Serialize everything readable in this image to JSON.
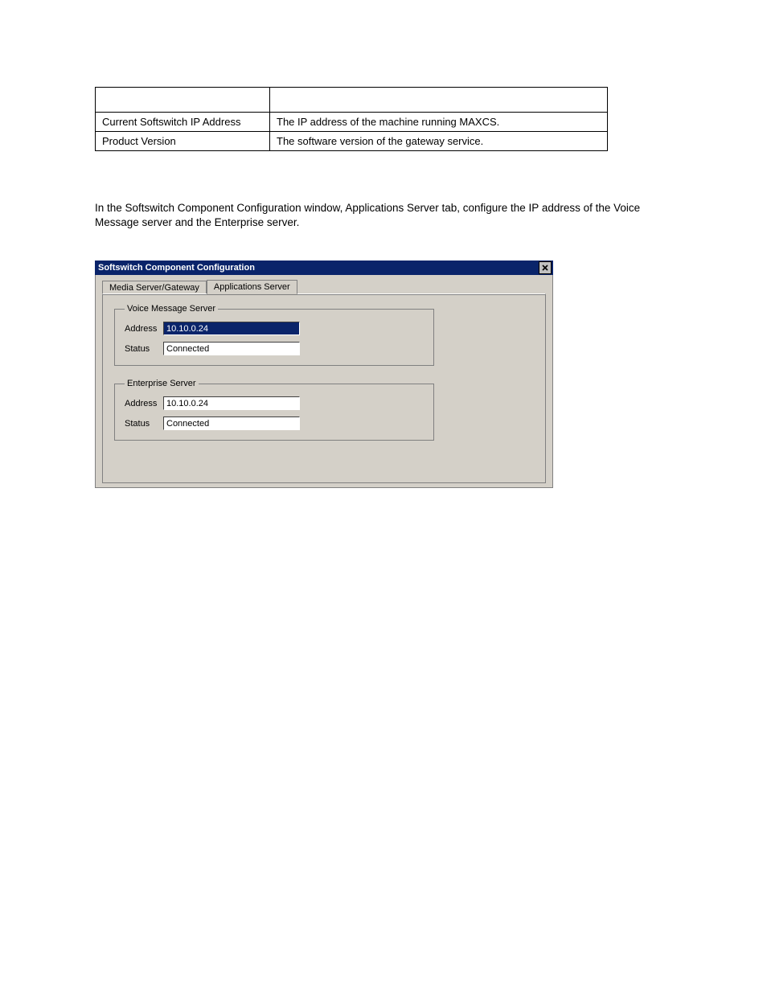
{
  "table": {
    "rows": [
      {
        "c1": "Current Softswitch IP Address",
        "c2": "The IP address of the machine running MAXCS."
      },
      {
        "c1": "Product Version",
        "c2": "The software version of the gateway service."
      }
    ]
  },
  "paragraph": "In the Softswitch Component Configuration window, Applications Server tab, configure the IP address of the Voice Message server and the Enterprise server.",
  "window": {
    "title": "Softswitch Component Configuration",
    "tabs": {
      "tab1": "Media Server/Gateway",
      "tab2": "Applications Server"
    },
    "voice": {
      "legend": "Voice Message Server",
      "addr_label": "Address",
      "addr_value": "10.10.0.24",
      "status_label": "Status",
      "status_value": "Connected"
    },
    "ent": {
      "legend": "Enterprise Server",
      "addr_label": "Address",
      "addr_value": "10.10.0.24",
      "status_label": "Status",
      "status_value": "Connected"
    }
  }
}
